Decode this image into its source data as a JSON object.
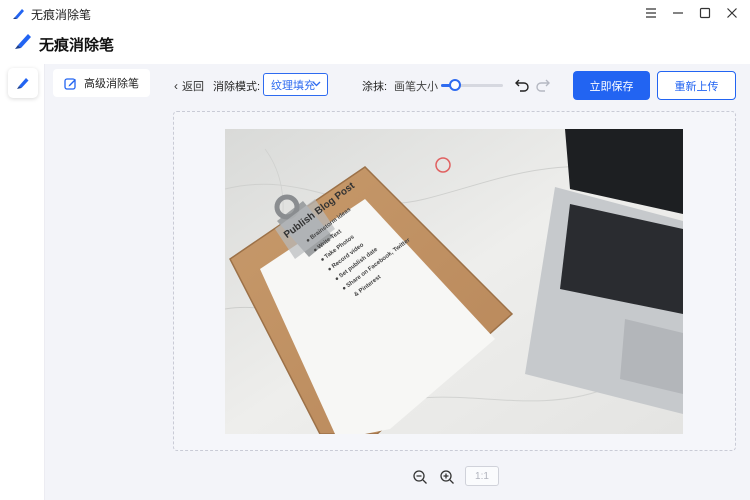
{
  "window": {
    "title": "无痕消除笔",
    "controls": [
      "menu-icon",
      "minimize-icon",
      "maximize-icon",
      "close-icon"
    ]
  },
  "header": {
    "title": "无痕消除笔"
  },
  "rail": {
    "items": [
      {
        "icon": "eraser-pen-icon"
      }
    ]
  },
  "sidebar": {
    "items": [
      {
        "icon": "edit-icon",
        "label": "高级消除笔"
      }
    ]
  },
  "toolbar": {
    "back_label": "返回",
    "mode_label": "消除模式:",
    "mode_value": "纹理填充",
    "brush_label": "涂抹:",
    "brush_size_label": "画笔大小",
    "brush_size_level": 0.15,
    "save_label": "立即保存",
    "reupload_label": "重新上传"
  },
  "canvas": {
    "clipboard_title": "Publish Blog Post",
    "checklist": [
      "Brainstorm ideas",
      "Write Text",
      "Take Photos",
      "Record video",
      "Set publish date",
      "Share on Facebook, Twitter",
      "& Pinterest"
    ]
  },
  "zoom": {
    "ratio_label": "1:1"
  },
  "colors": {
    "accent": "#2264f2",
    "panel_bg": "#f3f4f9"
  }
}
